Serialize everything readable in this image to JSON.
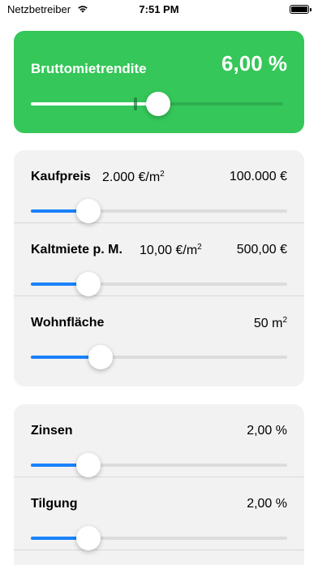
{
  "status_bar": {
    "carrier": "Netzbetreiber",
    "time": "7:51 PM"
  },
  "hero": {
    "label": "Bruttomietrendite",
    "value": "6,00 %",
    "slider_fraction": 0.5,
    "color": "#35c759"
  },
  "property": {
    "rows": [
      {
        "label": "Kaufpreis",
        "unit": "2.000 €/m",
        "unit_sup": "2",
        "value": "100.000 €",
        "value_sup": "",
        "slider_fraction": 0.22
      },
      {
        "label": "Kaltmiete p. M.",
        "unit": "10,00 €/m",
        "unit_sup": "2",
        "value": "500,00 €",
        "value_sup": "",
        "slider_fraction": 0.22
      },
      {
        "label": "Wohnfläche",
        "unit": "",
        "unit_sup": "",
        "value": "50 m",
        "value_sup": "2",
        "slider_fraction": 0.27
      }
    ]
  },
  "financing": {
    "rows": [
      {
        "label": "Zinsen",
        "value": "2,00 %",
        "slider_fraction": 0.22
      },
      {
        "label": "Tilgung",
        "value": "2,00 %",
        "slider_fraction": 0.22
      }
    ]
  },
  "accent_color": "#1a82fb"
}
